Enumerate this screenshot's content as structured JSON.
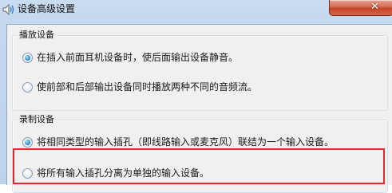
{
  "window": {
    "title": "设备高级设置",
    "close_glyph": "✕"
  },
  "playback_group": {
    "legend": "播放设备",
    "options": [
      {
        "label": "在插入前面耳机设备时，使后面输出设备静音。",
        "checked": true
      },
      {
        "label": "使前部和后部输出设备同时播放两种不同的音频流。",
        "checked": false
      }
    ]
  },
  "recording_group": {
    "legend": "录制设备",
    "options": [
      {
        "label": "将相同类型的输入插孔（即线路输入或麦克风）联结为一个输入设备。",
        "checked": true
      },
      {
        "label": "将所有输入插孔分离为单独的输入设备。",
        "checked": false
      }
    ]
  },
  "colors": {
    "highlight_border": "#e5262d",
    "titlebar": "#c9dcf0",
    "close_button": "#c7442a"
  }
}
